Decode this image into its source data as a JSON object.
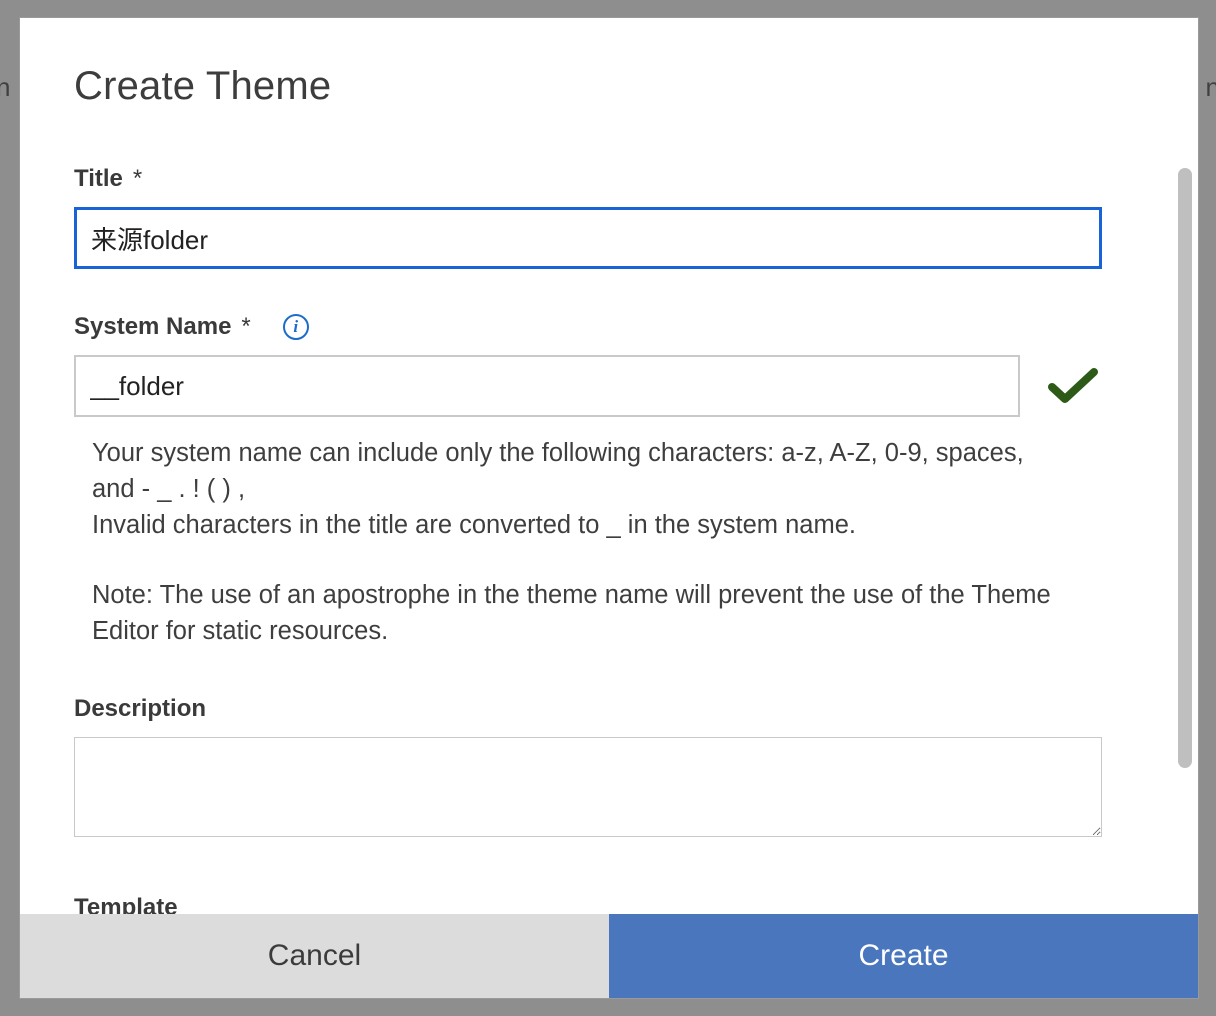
{
  "backdrop": {
    "cropped_letter": "n"
  },
  "modal": {
    "title": "Create Theme",
    "fields": {
      "title": {
        "label": "Title",
        "required_mark": "*",
        "value": "来源folder"
      },
      "system_name": {
        "label": "System Name",
        "required_mark": "*",
        "value": "__folder",
        "validation_state": "valid",
        "help_line1": "Your system name can include only the following characters: a-z, A-Z, 0-9, spaces, and - _ . ! ( ) ,",
        "help_line2": "Invalid characters in the title are converted to _ in the system name.",
        "help_line3": "Note: The use of an apostrophe in the theme name will prevent the use of the Theme Editor for static resources."
      },
      "description": {
        "label": "Description",
        "value": ""
      },
      "template": {
        "label": "Template"
      }
    },
    "footer": {
      "cancel_label": "Cancel",
      "create_label": "Create"
    }
  }
}
